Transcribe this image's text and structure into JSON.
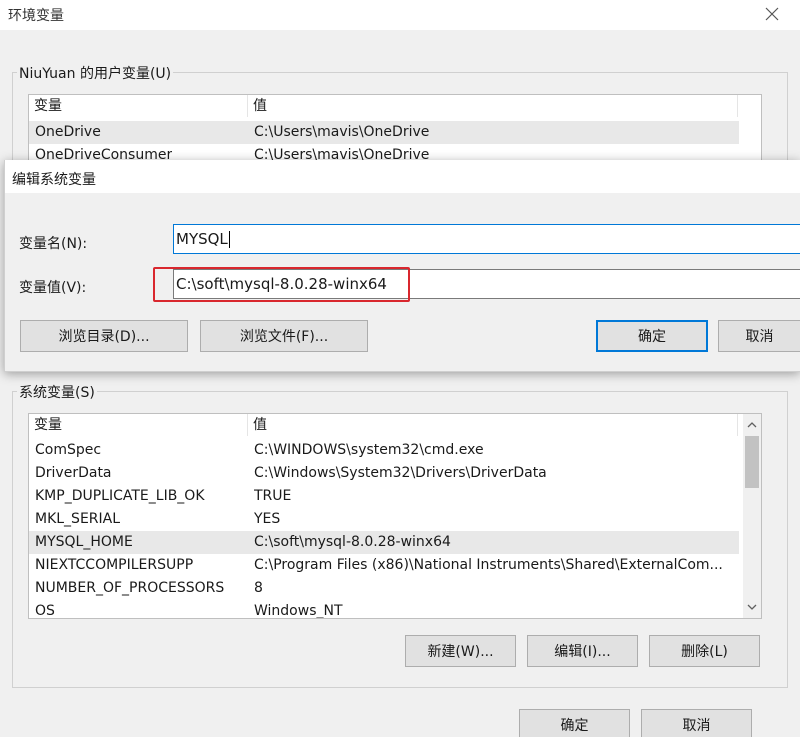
{
  "window": {
    "title": "环境变量"
  },
  "user_section": {
    "label": "NiuYuan 的用户变量(U)",
    "columns": [
      "变量",
      "值"
    ],
    "rows": [
      {
        "name": "OneDrive",
        "value": "C:\\Users\\mavis\\OneDrive"
      },
      {
        "name": "OneDriveConsumer",
        "value": "C:\\Users\\mavis\\OneDrive"
      }
    ]
  },
  "edit_dialog": {
    "title": "编辑系统变量",
    "name_label": "变量名(N):",
    "name_value": "MYSQL",
    "value_label": "变量值(V):",
    "value_value": "C:\\soft\\mysql-8.0.28-winx64",
    "browse_dir_label": "浏览目录(D)...",
    "browse_file_label": "浏览文件(F)...",
    "ok_label": "确定",
    "cancel_label": "取消"
  },
  "system_section": {
    "label": "系统变量(S)",
    "columns": [
      "变量",
      "值"
    ],
    "rows": [
      {
        "name": "ComSpec",
        "value": "C:\\WINDOWS\\system32\\cmd.exe"
      },
      {
        "name": "DriverData",
        "value": "C:\\Windows\\System32\\Drivers\\DriverData"
      },
      {
        "name": "KMP_DUPLICATE_LIB_OK",
        "value": "TRUE"
      },
      {
        "name": "MKL_SERIAL",
        "value": "YES"
      },
      {
        "name": "MYSQL_HOME",
        "value": "C:\\soft\\mysql-8.0.28-winx64"
      },
      {
        "name": "NIEXTCCOMPILERSUPP",
        "value": "C:\\Program Files (x86)\\National Instruments\\Shared\\ExternalCom..."
      },
      {
        "name": "NUMBER_OF_PROCESSORS",
        "value": "8"
      },
      {
        "name": "OS",
        "value": "Windows_NT"
      }
    ],
    "selected_row": "MYSQL_HOME",
    "new_label": "新建(W)...",
    "edit_label": "编辑(I)...",
    "delete_label": "删除(L)"
  },
  "footer": {
    "ok_label": "确定",
    "cancel_label": "取消"
  },
  "colors": {
    "accent": "#0078d7",
    "highlight": "#d9272e"
  },
  "icons": {
    "close": "close-icon",
    "scroll_up": "chevron-up-icon",
    "scroll_down": "chevron-down-icon"
  }
}
